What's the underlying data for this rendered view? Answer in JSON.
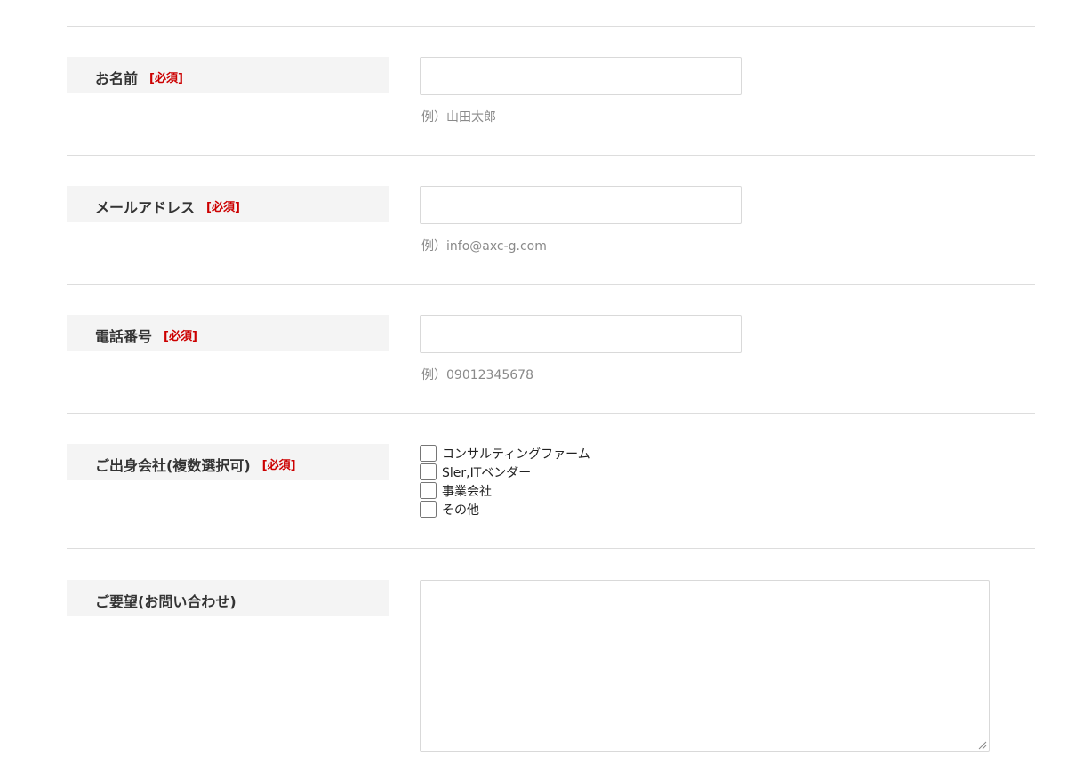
{
  "form": {
    "name": {
      "label": "お名前",
      "required": "[必須]",
      "value": "",
      "hint": "例）山田太郎"
    },
    "email": {
      "label": "メールアドレス",
      "required": "[必須]",
      "value": "",
      "hint": "例）info@axc-g.com"
    },
    "phone": {
      "label": "電話番号",
      "required": "[必須]",
      "value": "",
      "hint": "例）09012345678"
    },
    "company": {
      "label": "ご出身会社(複数選択可)",
      "required": "[必須]",
      "options": [
        {
          "label": "コンサルティングファーム",
          "checked": false
        },
        {
          "label": "Sler,ITベンダー",
          "checked": false
        },
        {
          "label": "事業会社",
          "checked": false
        },
        {
          "label": "その他",
          "checked": false
        }
      ]
    },
    "request": {
      "label": "ご要望(お問い合わせ)",
      "value": ""
    }
  },
  "colors": {
    "required": "#cc0000",
    "label_bg": "#f4f4f4",
    "divider": "#dddddd",
    "hint": "#8a8a8a"
  }
}
